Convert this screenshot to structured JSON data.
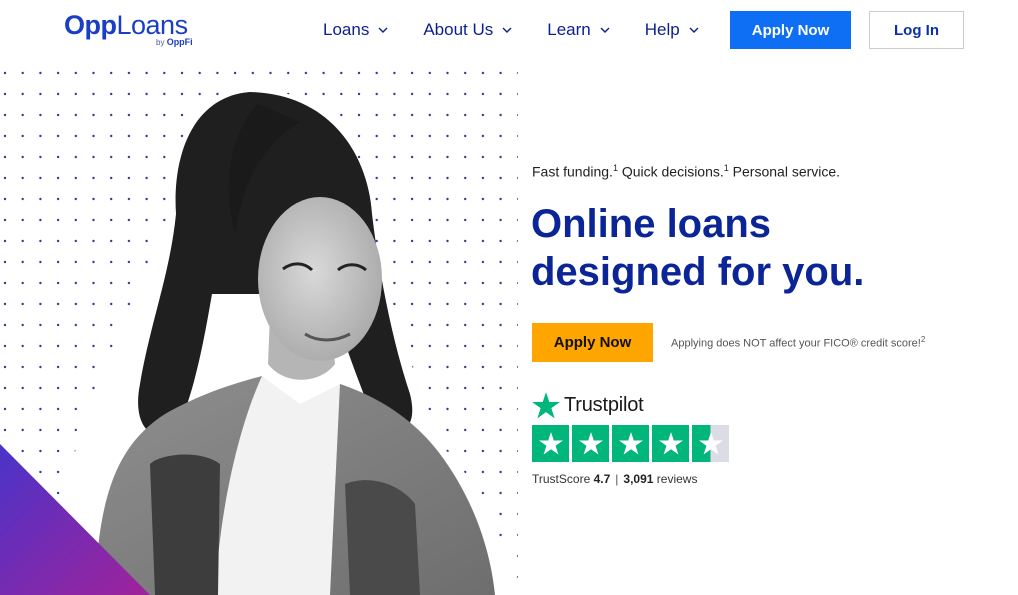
{
  "header": {
    "logo": {
      "brand_bold": "Opp",
      "brand_light": "Loans",
      "by_prefix": "by",
      "by_brand": "OppFi"
    },
    "nav": [
      {
        "label": "Loans"
      },
      {
        "label": "About Us"
      },
      {
        "label": "Learn"
      },
      {
        "label": "Help"
      }
    ],
    "apply_label": "Apply Now",
    "login_label": "Log In"
  },
  "hero": {
    "tagline": {
      "part1": "Fast funding.",
      "sup1": "1",
      "part2": " Quick decisions.",
      "sup2": "1",
      "part3": " Personal service."
    },
    "headline_line1": "Online loans",
    "headline_line2": "designed for you.",
    "apply_label": "Apply Now",
    "fico_note": "Applying does NOT affect your FICO® credit score!",
    "fico_sup": "2"
  },
  "trustpilot": {
    "name": "Trustpilot",
    "stars": 4.5,
    "score_label": "TrustScore",
    "score": "4.7",
    "reviews_count": "3,091",
    "reviews_label": "reviews"
  },
  "colors": {
    "brand_blue": "#0b2596",
    "apply_blue": "#0e6ff5",
    "cta_orange": "#ffa500",
    "trustpilot_green": "#00b67a",
    "accent_purple": "#6a2bbf"
  }
}
